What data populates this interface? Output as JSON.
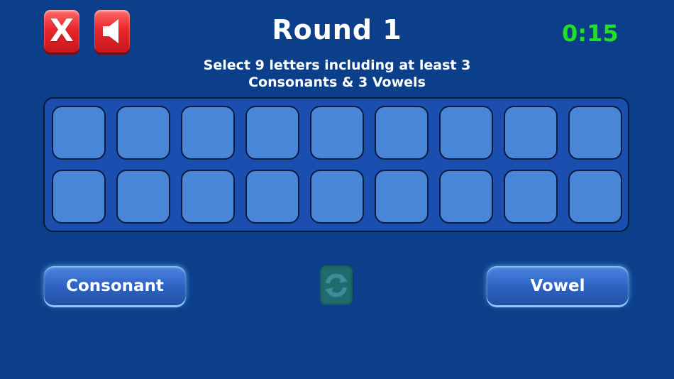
{
  "header": {
    "title": "Round 1",
    "timer": "0:15"
  },
  "instructions": {
    "line1": "Select 9 letters including at least 3",
    "line2": "Consonants & 3 Vowels"
  },
  "buttons": {
    "close_icon": "close-x-icon",
    "close_label": "X",
    "sound_icon": "speaker-icon",
    "consonant_label": "Consonant",
    "vowel_label": "Vowel",
    "refresh_icon": "refresh-arrows-icon"
  },
  "board": {
    "rows": [
      [
        "",
        "",
        "",
        "",
        "",
        "",
        "",
        "",
        ""
      ],
      [
        "",
        "",
        "",
        "",
        "",
        "",
        "",
        "",
        ""
      ]
    ]
  },
  "colors": {
    "background": "#0b3f8a",
    "board": "#1a4fb0",
    "tile": "#4a86d8",
    "timer": "#22e024",
    "icon_button": "#e8262b",
    "refresh_button": "#1f6b6d"
  }
}
